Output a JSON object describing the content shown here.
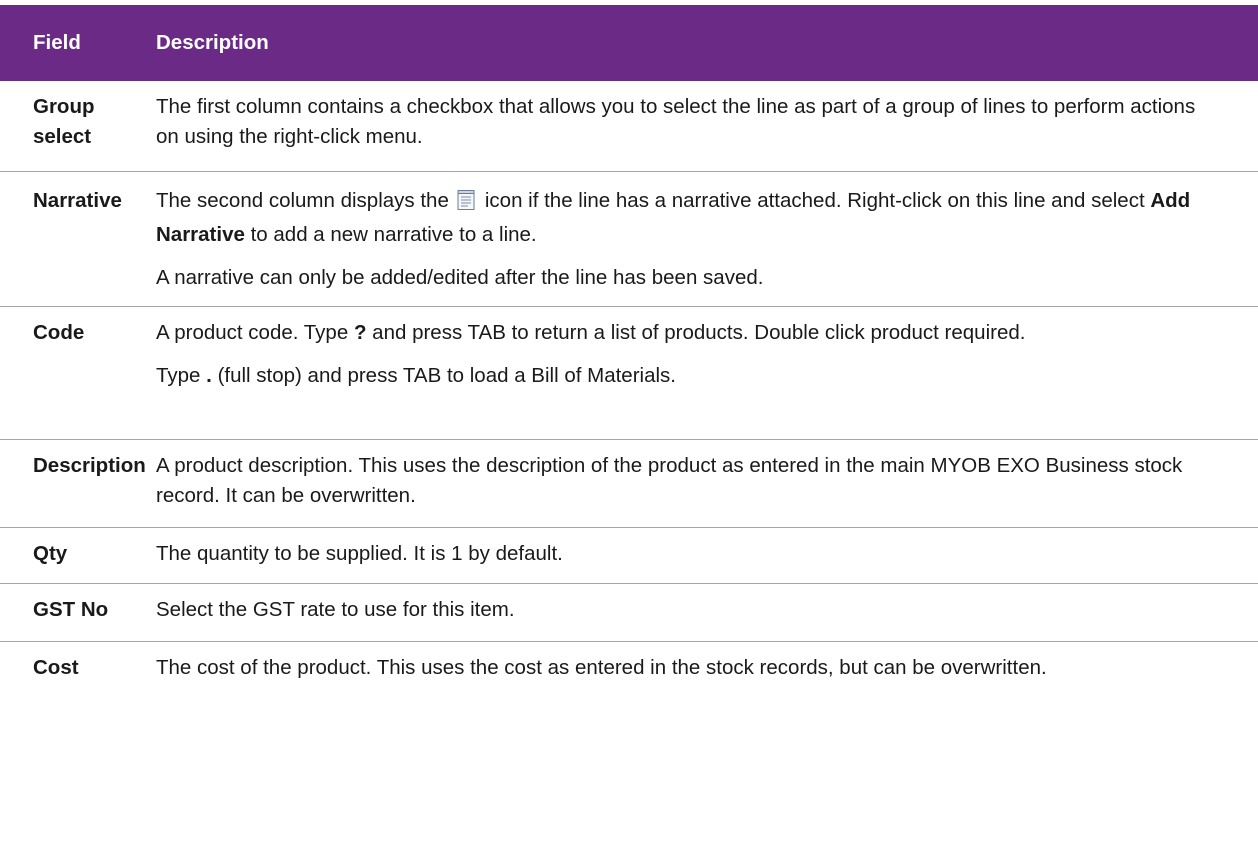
{
  "header": {
    "field": "Field",
    "description": "Description"
  },
  "rows": [
    {
      "field": "Group select",
      "desc": "The first column contains a checkbox that allows you to select the line as part of a group of lines to perform actions on using the right-click menu."
    },
    {
      "field": "Narrative",
      "p1_a": "The second column displays the",
      "icon": "narrative-note-icon",
      "p1_b": "icon if the line has a narrative attached. Right-click on this line and select",
      "p1_bold": "Add Narrative",
      "p1_c": "to add a new narrative to a line.",
      "p2": "A narrative can only be added/edited after the line has been saved."
    },
    {
      "field": "Code",
      "p1_a": "A product code. Type",
      "p1_bold": "?",
      "p1_b": "and press TAB to return a list of products. Double click product required.",
      "p2_a": "Type",
      "p2_bold": ".",
      "p2_b": "(full stop) and press TAB to load a Bill of Materials."
    },
    {
      "field": "Description",
      "desc": "A product description. This uses the description of the product as entered in the main MYOB EXO Business stock record. It can be overwritten."
    },
    {
      "field": "Qty",
      "desc": "The quantity to be supplied. It is 1 by default."
    },
    {
      "field": "GST No",
      "desc": "Select the GST rate to use for this item."
    },
    {
      "field": "Cost",
      "desc": "The cost of the product. This uses the cost as entered in the stock records, but can be overwritten."
    }
  ],
  "colors": {
    "header_bg": "#6a2a86",
    "header_text": "#ffffff",
    "divider": "#a6a6a6"
  }
}
